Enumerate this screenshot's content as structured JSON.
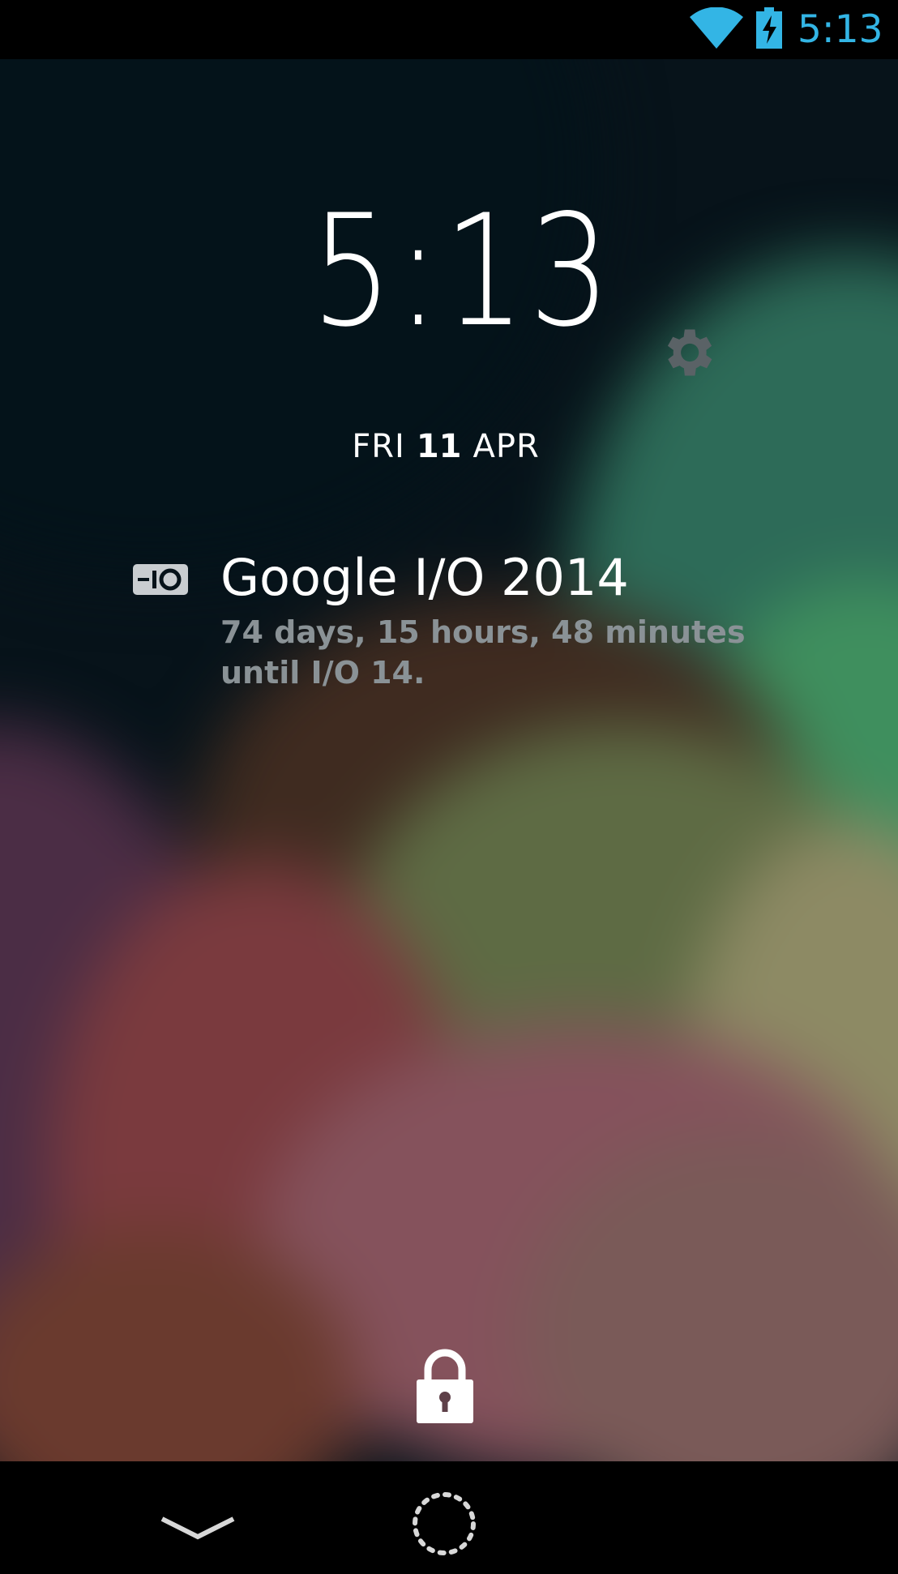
{
  "status_bar": {
    "time": "5:13",
    "icons": [
      "wifi-icon",
      "battery-charging-icon"
    ],
    "accent_color": "#33B5E5"
  },
  "lockscreen": {
    "clock": {
      "time": "5:13",
      "weekday": "FRI",
      "day": "11",
      "month": "APR"
    },
    "settings_icon": "gear-icon",
    "widget": {
      "icon": "google-io-logo-icon",
      "title": "Google I/O 2014",
      "text": "74 days, 15 hours, 48 minutes until I/O 14."
    },
    "lock_icon": "lock-icon"
  },
  "nav_bar": {
    "icons": [
      "back-chevron-icon",
      "home-circle-icon"
    ]
  }
}
